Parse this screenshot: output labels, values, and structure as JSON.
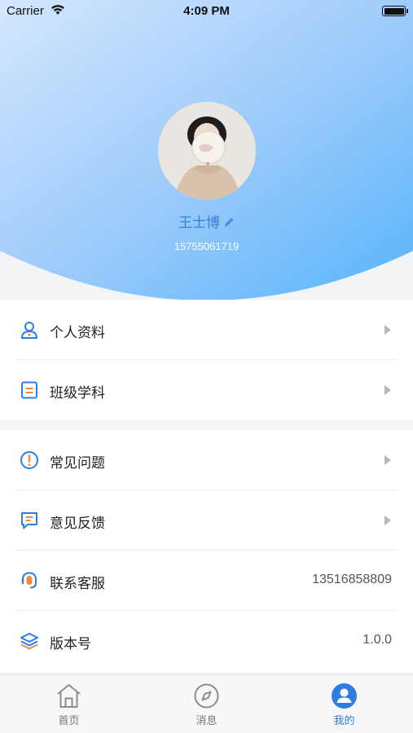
{
  "status_bar": {
    "carrier": "Carrier",
    "time": "4:09 PM"
  },
  "colors": {
    "accent": "#2d7ee0",
    "header_gradient_start": "#cfe4fd",
    "header_gradient_end": "#5fb8fb"
  },
  "profile": {
    "name": "王士博",
    "phone": "15755061719"
  },
  "menu_group_1": [
    {
      "label": "个人资料",
      "icon": "user-icon"
    },
    {
      "label": "班级学科",
      "icon": "class-icon"
    }
  ],
  "menu_group_2": [
    {
      "label": "常见问题",
      "icon": "question-icon"
    },
    {
      "label": "意见反馈",
      "icon": "feedback-icon"
    },
    {
      "label": "联系客服",
      "icon": "headset-icon",
      "value": "13516858809"
    },
    {
      "label": "版本号",
      "icon": "layers-icon",
      "value": "1.0.0"
    }
  ],
  "tabbar": [
    {
      "label": "首页",
      "icon": "home-icon",
      "active": false
    },
    {
      "label": "消息",
      "icon": "compass-icon",
      "active": false
    },
    {
      "label": "我的",
      "icon": "profile-icon",
      "active": true
    }
  ]
}
